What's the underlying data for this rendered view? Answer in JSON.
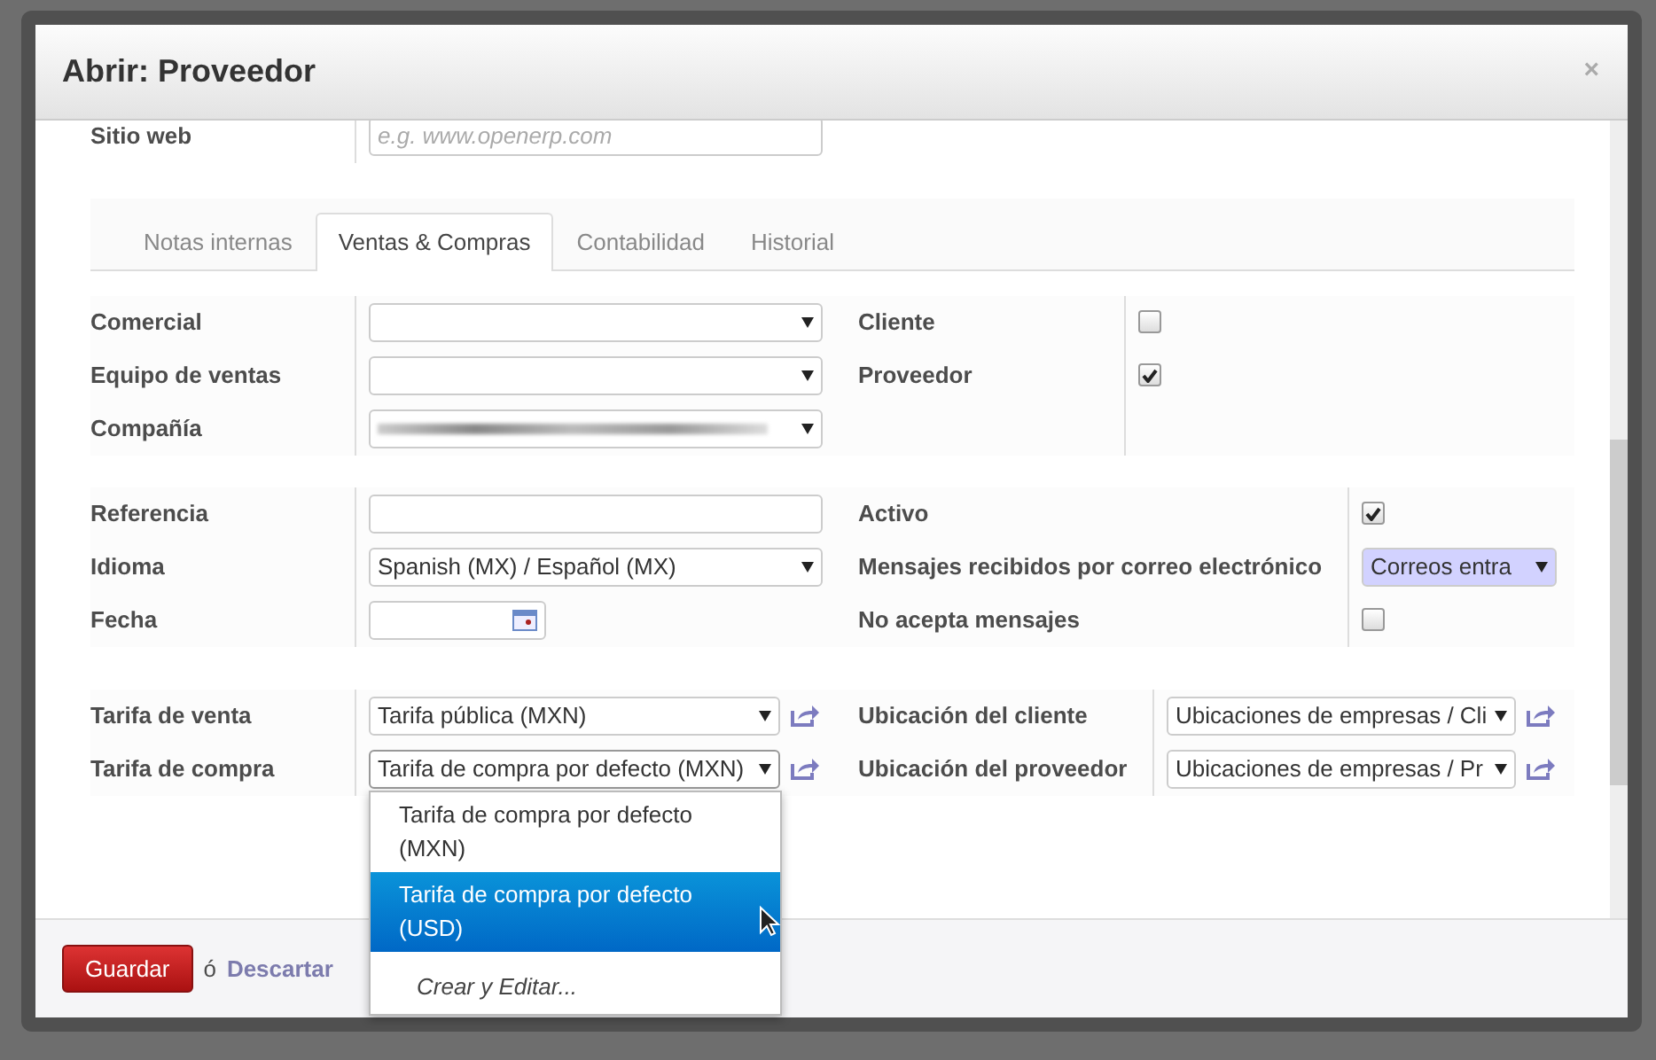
{
  "window": {
    "title": "Abrir: Proveedor",
    "close": "×"
  },
  "website": {
    "label": "Sitio web",
    "placeholder": "e.g. www.openerp.com"
  },
  "tabs": [
    {
      "label": "Notas internas",
      "selected": false
    },
    {
      "label": "Ventas & Compras",
      "selected": true
    },
    {
      "label": "Contabilidad",
      "selected": false
    },
    {
      "label": "Historial",
      "selected": false
    }
  ],
  "groups": [
    {
      "left": [
        {
          "label": "Comercial",
          "kind": "select"
        },
        {
          "label": "Equipo de ventas",
          "kind": "select"
        },
        {
          "label": "Compañía",
          "kind": "redacted"
        }
      ],
      "right": [
        {
          "label": "Cliente",
          "kind": "checkbox",
          "checked": false
        },
        {
          "label": "Proveedor",
          "kind": "checkbox",
          "checked": true
        }
      ]
    },
    {
      "left": [
        {
          "label": "Referencia",
          "kind": "input"
        },
        {
          "label": "Idioma",
          "kind": "select",
          "value": "Spanish (MX) / Español (MX)"
        },
        {
          "label": "Fecha",
          "kind": "date"
        }
      ],
      "right": [
        {
          "label": "Activo",
          "kind": "checkbox",
          "checked": true
        },
        {
          "label": "Mensajes recibidos por correo electrónico",
          "kind": "highlight_select",
          "value": "Correos entra"
        },
        {
          "label": "No acepta mensajes",
          "kind": "checkbox",
          "checked": false
        }
      ]
    },
    {
      "left": [
        {
          "label": "Tarifa de venta",
          "kind": "link_select",
          "value": "Tarifa pública (MXN)"
        },
        {
          "label": "Tarifa de compra",
          "kind": "link_select",
          "value": "Tarifa de compra por defecto (MXN)",
          "open": true
        }
      ],
      "right": [
        {
          "label": "Ubicación del cliente",
          "kind": "link_select",
          "value": "Ubicaciones de empresas / Cli"
        },
        {
          "label": "Ubicación del proveedor",
          "kind": "link_select",
          "value": "Ubicaciones de empresas / Pr"
        }
      ]
    }
  ],
  "dropdown": {
    "options": [
      {
        "label": "Tarifa de compra por defecto (MXN)",
        "selected": false
      },
      {
        "label": "Tarifa de compra por defecto (USD)",
        "selected": true
      }
    ],
    "create": "Crear y Editar..."
  },
  "footer": {
    "save": "Guardar",
    "or": "ó",
    "discard": "Descartar"
  }
}
